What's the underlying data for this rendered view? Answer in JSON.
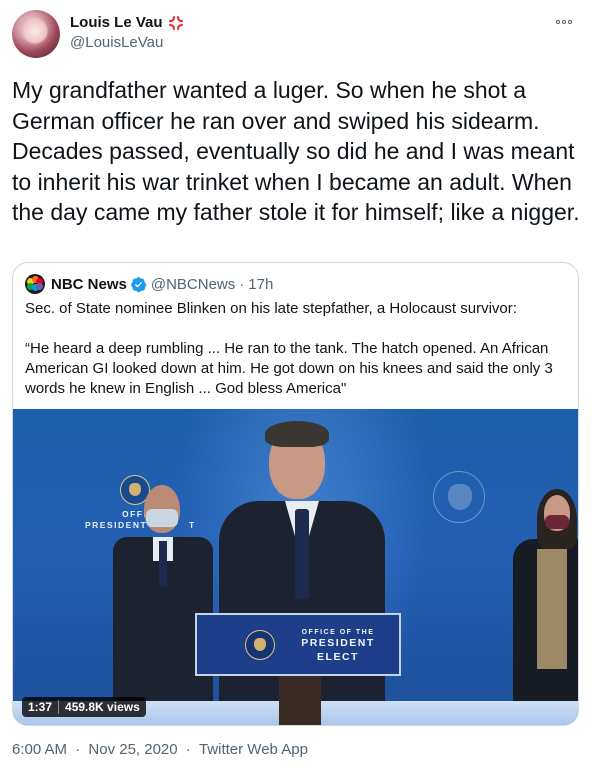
{
  "author": {
    "display_name": "Louis Le Vau",
    "handle": "@LouisLeVau",
    "avatar_icon": "avatar-image",
    "badge_icon": "anger-symbol-icon"
  },
  "tweet": {
    "text": "My grandfather wanted a luger. So when he shot a German officer he ran over and swiped his sidearm. Decades passed, eventually so did he and I was meant to inherit his war trinket when I became an adult. When the day came my father stole it for himself; like a nigger."
  },
  "quoted_tweet": {
    "display_name": "NBC News",
    "handle": "@NBCNews",
    "separator": "·",
    "time": "17h",
    "text": "Sec. of State nominee Blinken on his late stepfather, a Holocaust survivor:\n\n“He heard a deep rumbling ... He ran to the tank. The hatch opened. An African American GI looked down at him. He got down on his knees and said the only 3 words he knew in English ... God bless America\"",
    "media": {
      "duration": "1:37",
      "views": "459.8K views",
      "wall_text_line1": "OFFIC",
      "wall_text_line2": "PRESIDENT",
      "wall_text_line2b": "T",
      "podium_small": "OFFICE OF THE",
      "podium_line1": "PRESIDENT",
      "podium_line2": "ELECT"
    }
  },
  "meta": {
    "time": "6:00 AM",
    "separator": "·",
    "date": "Nov 25, 2020",
    "source": "Twitter Web App"
  },
  "colors": {
    "text_primary": "#0f1419",
    "text_secondary": "#536471",
    "border": "#cfd9de",
    "verified": "#1d9bf0",
    "anger": "#f4212e"
  }
}
